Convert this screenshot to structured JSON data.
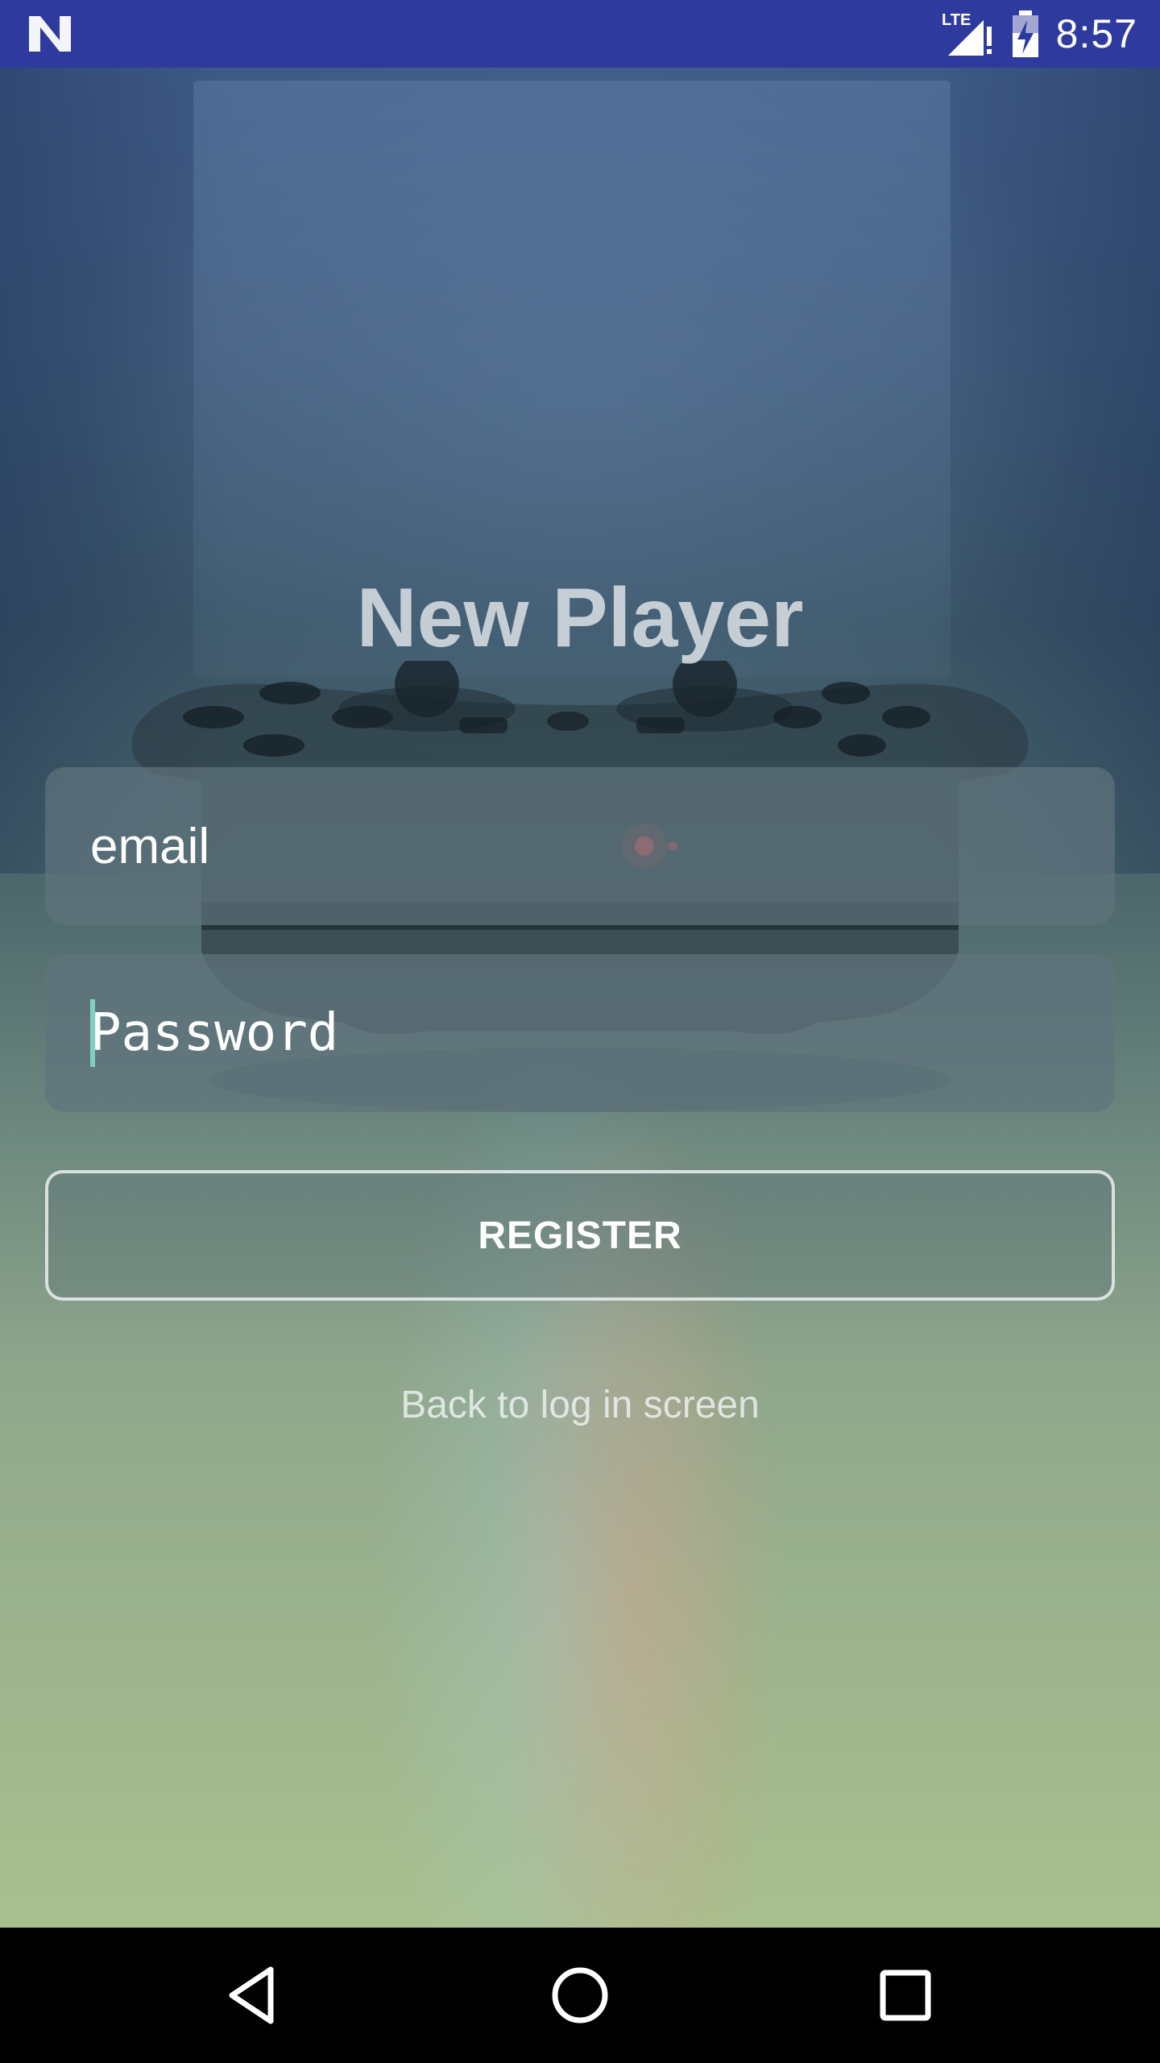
{
  "status_bar": {
    "time": "8:57",
    "network_label": "LTE",
    "notification_icon": "n-logo-icon",
    "signal_icon": "signal-alert-icon",
    "battery_icon": "battery-charging-icon"
  },
  "screen": {
    "title": "New Player",
    "email_field": {
      "placeholder": "email",
      "value": ""
    },
    "password_field": {
      "placeholder": "Password",
      "value": ""
    },
    "register_label": "REGISTER",
    "back_link_label": "Back to log in screen"
  },
  "nav_bar": {
    "back_icon": "back-triangle-icon",
    "home_icon": "home-circle-icon",
    "recents_icon": "recents-square-icon"
  },
  "colors": {
    "status_bar": "#2f3a9e",
    "accent_cursor": "#7fd0c0"
  }
}
